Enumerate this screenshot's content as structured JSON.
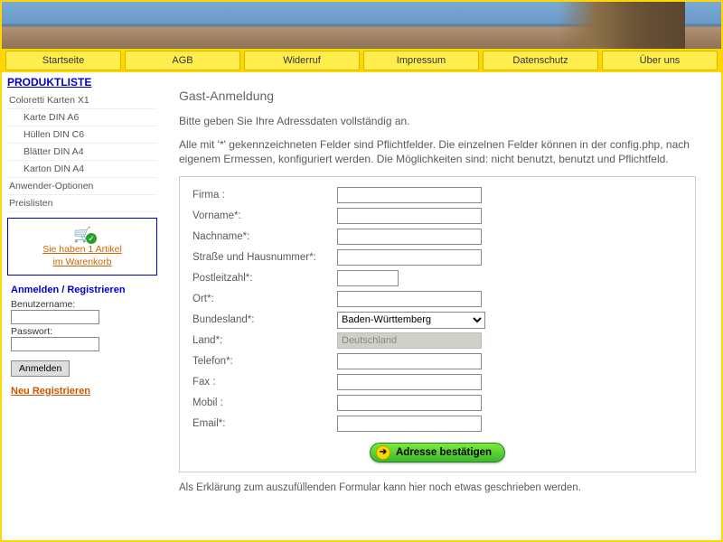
{
  "nav": {
    "items": [
      "Startseite",
      "AGB",
      "Widerruf",
      "Impressum",
      "Datenschutz",
      "Über uns"
    ]
  },
  "sidebar": {
    "title": "PRODUKTLISTE",
    "cats": [
      "Coloretti Karten X1",
      "Karte DIN A6",
      "Hüllen DIN C6",
      "Blätter DIN A4",
      "Karton DIN A4",
      "Anwender-Optionen",
      "Preislisten"
    ],
    "cart_line1": "Sie haben 1 Artikel",
    "cart_line2": "im Warenkorb",
    "login_title": "Anmelden / Registrieren",
    "user_label": "Benutzername:",
    "pass_label": "Passwort:",
    "login_btn": "Anmelden",
    "register": "Neu Registrieren"
  },
  "main": {
    "heading": "Gast-Anmeldung",
    "intro1": "Bitte geben Sie Ihre Adressdaten vollständig an.",
    "intro2": "Alle mit '*' gekennzeichneten Felder sind Pflichtfelder. Die einzelnen Felder können in der config.php, nach eigenem Ermessen, konfiguriert werden. Die Möglichkeiten sind: nicht benutzt, benutzt und Pflichtfeld.",
    "fields": {
      "firma": "Firma :",
      "vorname": "Vorname*:",
      "nachname": "Nachname*:",
      "strasse": "Straße und Hausnummer*:",
      "plz": "Postleitzahl*:",
      "ort": "Ort*:",
      "bundesland": "Bundesland*:",
      "land": "Land*:",
      "telefon": "Telefon*:",
      "fax": "Fax :",
      "mobil": "Mobil :",
      "email": "Email*:"
    },
    "bundesland_opt": "Baden-Württemberg",
    "land_value": "Deutschland",
    "confirm": "Adresse bestätigen",
    "footnote": "Als Erklärung zum auszufüllenden Formular kann hier noch etwas geschrieben werden."
  }
}
